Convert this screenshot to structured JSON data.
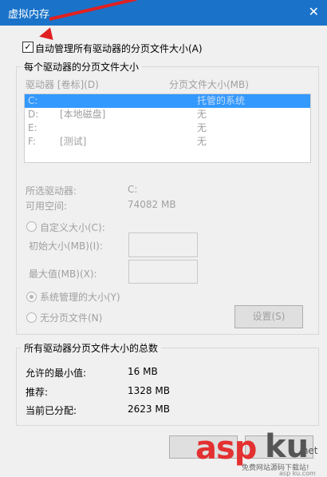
{
  "window": {
    "title": "虚拟内存",
    "close_glyph": "✕"
  },
  "auto_manage": {
    "label": "自动管理所有驱动器的分页文件大小(A)",
    "checked": true,
    "check_glyph": "✓"
  },
  "per_drive_group": {
    "legend": "每个驱动器的分页文件大小",
    "col_drive": "驱动器 [卷标](D)",
    "col_size": "分页文件大小(MB)",
    "drives": [
      {
        "letter": "C:",
        "label": "",
        "size": "托管的系统",
        "selected": true
      },
      {
        "letter": "D:",
        "label": "[本地磁盘]",
        "size": "无",
        "selected": false
      },
      {
        "letter": "E:",
        "label": "",
        "size": "无",
        "selected": false
      },
      {
        "letter": "F:",
        "label": "[测试]",
        "size": "无",
        "selected": false
      }
    ],
    "selected_drive_label": "所选驱动器:",
    "selected_drive_value": "C:",
    "free_space_label": "可用空间:",
    "free_space_value": "74082 MB",
    "custom_size_label": "自定义大小(C):",
    "initial_size_label": "初始大小(MB)(I):",
    "max_size_label": "最大值(MB)(X):",
    "system_managed_label": "系统管理的大小(Y)",
    "no_paging_label": "无分页文件(N)",
    "set_button": "设置(S)"
  },
  "totals_group": {
    "legend": "所有驱动器分页文件大小的总数",
    "min_label": "允许的最小值:",
    "min_value": "16 MB",
    "recommended_label": "推荐:",
    "recommended_value": "1328 MB",
    "current_label": "当前已分配:",
    "current_value": "2623 MB"
  },
  "watermark": {
    "asp": "asp",
    "ku": "ku",
    "net": ".net",
    "sub": "免费网站源码下载站!",
    "sub2": "asp ku.com"
  },
  "colors": {
    "titlebar": "#1a73c9",
    "selection": "#3399ff",
    "arrow": "#e02020",
    "watermark_red": "#e33030"
  }
}
